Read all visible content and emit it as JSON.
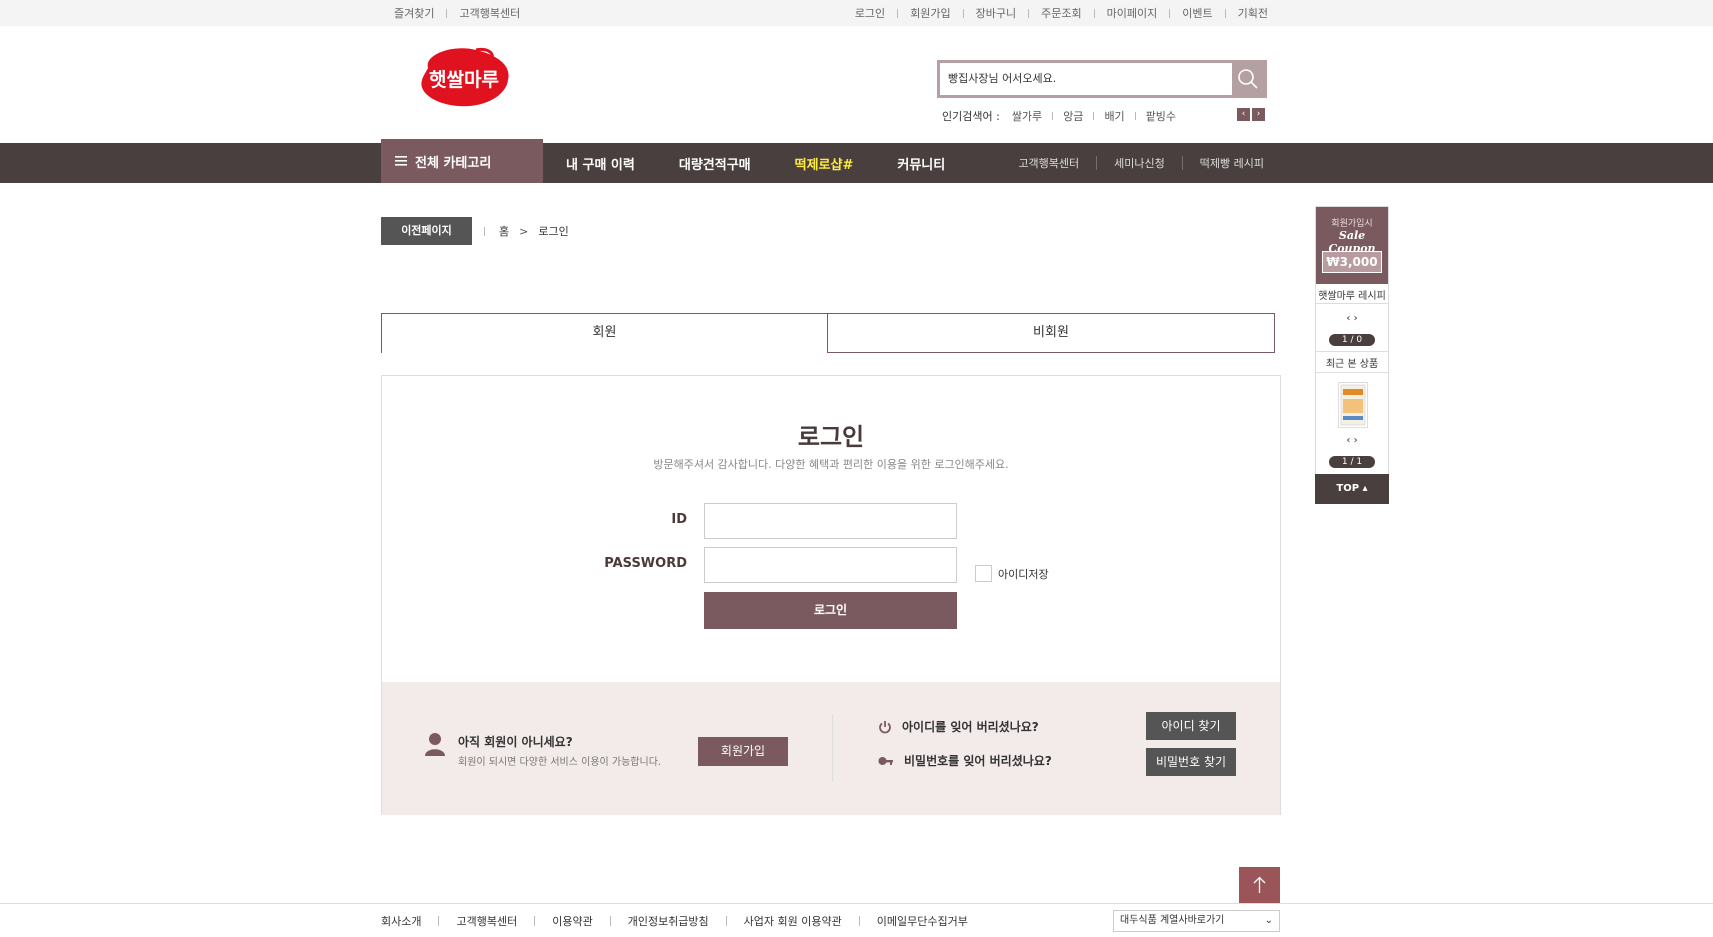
{
  "topbar": {
    "left": [
      "즐겨찾기",
      "고객행복센터"
    ],
    "right": [
      "로그인",
      "회원가입",
      "장바구니",
      "주문조회",
      "마이페이지",
      "이벤트",
      "기획전"
    ]
  },
  "header": {
    "logo_text": "햇쌀마루",
    "search_value": "빵집사장님 어서오세요.",
    "popular_label": "인기검색어 :",
    "popular": [
      "쌀가루",
      "앙금",
      "배기",
      "팥빙수"
    ]
  },
  "nav": {
    "all_category": "전체 카테고리",
    "menu": [
      "내 구매 이력",
      "대량견적구매",
      "떡제로샵#",
      "커뮤니티"
    ],
    "sub": [
      "고객행복센터",
      "세미나신청",
      "떡제빵 레시피"
    ]
  },
  "breadcrumb": {
    "prev_button": "이전페이지",
    "home": "홈",
    "arrow": ">",
    "current": "로그인"
  },
  "tabs": [
    "회원",
    "비회원"
  ],
  "login": {
    "title": "로그인",
    "subtitle": "방문해주셔서 감사합니다. 다양한 혜택과 편리한 이용을 위한 로그인해주세요.",
    "id_label": "ID",
    "password_label": "PASSWORD",
    "save_id_label": "아이디저장",
    "login_button": "로그인"
  },
  "bottom": {
    "join_question": "아직 회원이 아니세요?",
    "join_desc": "회원이 되시면 다양한 서비스 이용이 가능합니다.",
    "join_button": "회원가입",
    "forgot_id": "아이디를 잊어 버리셨나요?",
    "forgot_pw": "비밀번호를 잊어 버리셨나요?",
    "find_id_button": "아이디 찾기",
    "find_pw_button": "비밀번호 찾기"
  },
  "side": {
    "coupon_line1": "회원가입시",
    "coupon_line2": "Sale Coupon",
    "coupon_amount": "₩3,000",
    "recipe_title": "햇쌀마루 레시피",
    "recipe_pager": "1 / 0",
    "recent_title": "최근 본 상품",
    "recent_pager": "1 / 1",
    "arrows": "‹  ›",
    "top": "TOP  ▴"
  },
  "footer": {
    "links": [
      "회사소개",
      "고객행복센터",
      "이용약관",
      "개인정보취급방침",
      "사업자 회원 이용약관",
      "이메일무단수집거부"
    ],
    "family_select": "대두식품 계열사바로가기"
  },
  "colors": {
    "brand": "#7b5a5f",
    "nav_bg": "#4a3f3f",
    "highlight": "#ffec3d",
    "logo_red": "#e0121f"
  }
}
